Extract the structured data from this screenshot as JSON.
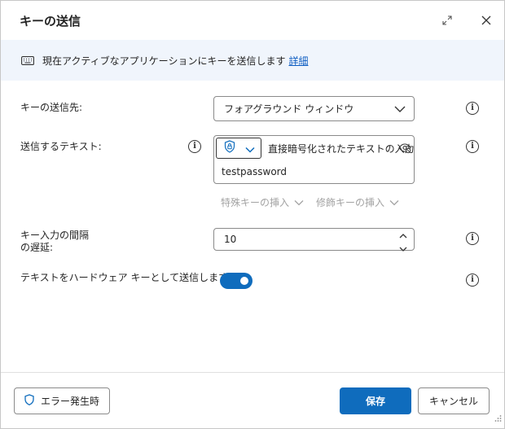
{
  "dialog": {
    "title": "キーの送信"
  },
  "info_bar": {
    "text": "現在アクティブなアプリケーションにキーを送信します",
    "link": "詳細"
  },
  "fields": {
    "target": {
      "label": "キーの送信先:",
      "value": "フォアグラウンド ウィンドウ"
    },
    "text_to_send": {
      "label": "送信するテキスト:",
      "mode_text": "直接暗号化されたテキストの入力",
      "value": "testpassword",
      "special_keys": "特殊キーの挿入",
      "modifier_keys": "修飾キーの挿入"
    },
    "delay": {
      "label_line1": "キー入力の間隔",
      "label_line2": "の遅延:",
      "value": "10"
    },
    "hardware_keys": {
      "label": "テキストをハードウェア キーとして送信します:",
      "enabled": true
    }
  },
  "footer": {
    "on_error": "エラー発生時",
    "save": "保存",
    "cancel": "キャンセル"
  },
  "colors": {
    "accent": "#0f6cbd",
    "info_bg": "#f0f5fc",
    "link": "#0f5ec2"
  }
}
